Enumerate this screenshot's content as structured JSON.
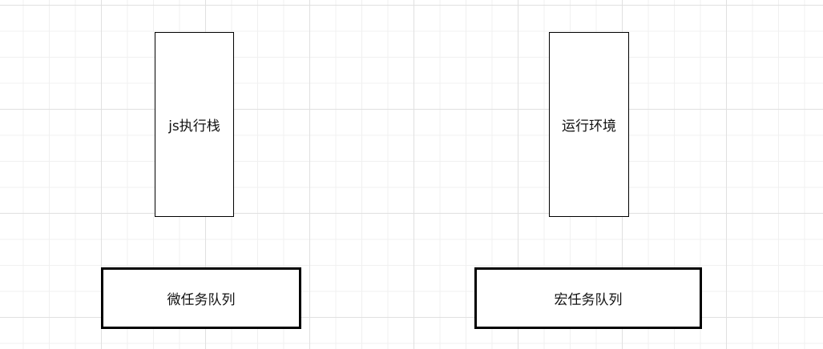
{
  "nodes": {
    "js_stack": "js执行栈",
    "runtime_env": "运行环境",
    "micro_queue": "微任务队列",
    "macro_queue": "宏任务队列"
  }
}
